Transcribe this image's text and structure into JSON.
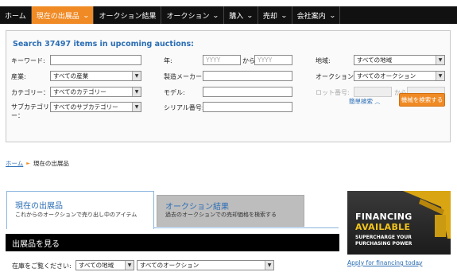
{
  "nav": {
    "items": [
      {
        "label": "ホーム",
        "dropdown": false,
        "active": false
      },
      {
        "label": "現在の出展品",
        "dropdown": true,
        "active": true
      },
      {
        "label": "オークション結果",
        "dropdown": false,
        "active": false
      },
      {
        "label": "オークション",
        "dropdown": true,
        "active": false
      },
      {
        "label": "購入",
        "dropdown": true,
        "active": false
      },
      {
        "label": "売却",
        "dropdown": true,
        "active": false
      },
      {
        "label": "会社案内",
        "dropdown": true,
        "active": false
      }
    ],
    "chevron": "⌄"
  },
  "search": {
    "title": "Search 37497 items in upcoming auctions:",
    "keyword_label": "キーワード:",
    "year_label": "年:",
    "year_from_placeholder": "YYYY",
    "year_sep": "から",
    "year_to_placeholder": "YYYY",
    "region_label": "地域:",
    "region_value": "すべての地域",
    "industry_label": "産業:",
    "industry_value": "すべての産業",
    "maker_label": "製造メーカー:",
    "auction_label": "オークション:",
    "auction_value": "すべてのオークション",
    "category_label": "カテゴリー：",
    "category_value": "すべてのカテゴリー",
    "model_label": "モデル:",
    "lot_label": "ロット番号:",
    "lot_sep": "から",
    "subcategory_label": "サブカテゴリー：",
    "subcategory_value": "すべてのサブカテゴリー",
    "serial_label": "シリアル番号:",
    "simple_search": "簡単検索",
    "simple_search_icon": "chevron-up-icon",
    "search_button": "機械を検索する"
  },
  "breadcrumb": {
    "home": "ホーム",
    "current": "現在の出展品",
    "separator": "►"
  },
  "tabs": [
    {
      "title": "現在の出展品",
      "subtitle": "これからのオークションで売り出し中のアイテム",
      "active": true
    },
    {
      "title": "オークション結果",
      "subtitle": "過去のオークションでの売却価格を検索する",
      "active": false
    }
  ],
  "section": {
    "title": "出展品を見る",
    "inventory_label": "在庫をご覧ください:",
    "region_value": "すべての地域",
    "auction_value": "すべてのオークション"
  },
  "ad": {
    "line1": "FINANCING",
    "line2": "AVAILABLE",
    "line3": "SUPERCHARGE YOUR",
    "line4": "PURCHASING POWER",
    "link": "Apply for financing today",
    "link_suffix": "."
  },
  "colors": {
    "accent": "#f08a24",
    "link": "#2a6db5",
    "nav_bg": "#111111"
  }
}
